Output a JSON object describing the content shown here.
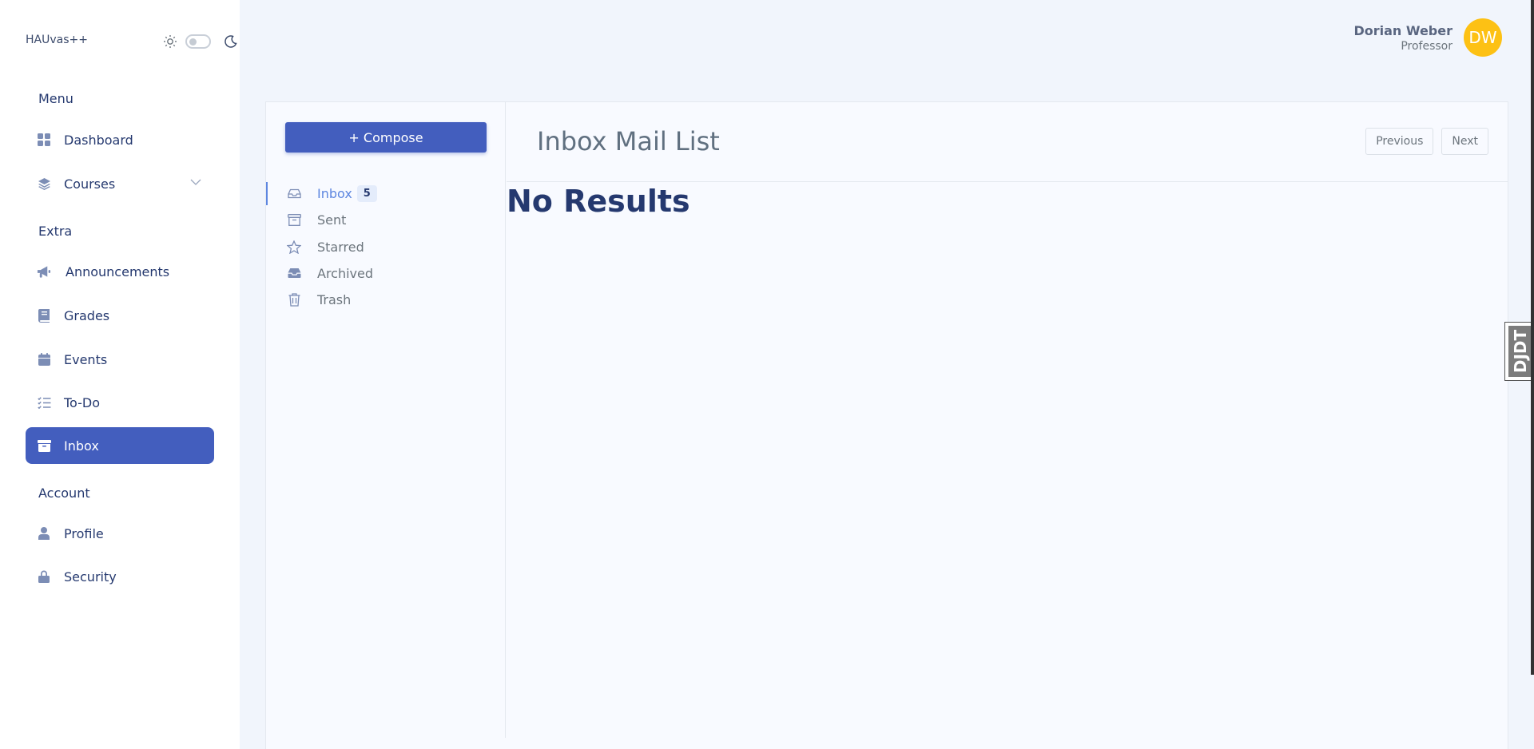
{
  "brand": "HAUvas++",
  "user": {
    "name": "Dorian Weber",
    "role": "Professor",
    "initials": "DW"
  },
  "sidebar": {
    "sections": [
      {
        "title": "Menu"
      },
      {
        "title": "Extra"
      },
      {
        "title": "Account"
      }
    ],
    "items": [
      {
        "label": "Dashboard",
        "icon": "grid-icon"
      },
      {
        "label": "Courses",
        "icon": "stack-icon"
      },
      {
        "label": "Announcements",
        "icon": "megaphone-icon"
      },
      {
        "label": "Grades",
        "icon": "book-icon"
      },
      {
        "label": "Events",
        "icon": "calendar-icon"
      },
      {
        "label": "To-Do",
        "icon": "list-check-icon"
      },
      {
        "label": "Inbox",
        "icon": "archive-icon",
        "active": true
      },
      {
        "label": "Profile",
        "icon": "person-icon"
      },
      {
        "label": "Security",
        "icon": "lock-icon"
      }
    ]
  },
  "mail": {
    "compose_label": "+ Compose",
    "folders": [
      {
        "label": "Inbox",
        "badge": "5",
        "active": true
      },
      {
        "label": "Sent"
      },
      {
        "label": "Starred"
      },
      {
        "label": "Archived"
      },
      {
        "label": "Trash"
      }
    ],
    "title": "Inbox Mail List",
    "previous_label": "Previous",
    "next_label": "Next",
    "empty_text": "No Results"
  },
  "debug_toolbar": {
    "label": "DJDT"
  },
  "colors": {
    "primary": "#435ebe",
    "avatar": "#fdc114",
    "text": "#25396f",
    "active_link": "#5d86e0"
  }
}
